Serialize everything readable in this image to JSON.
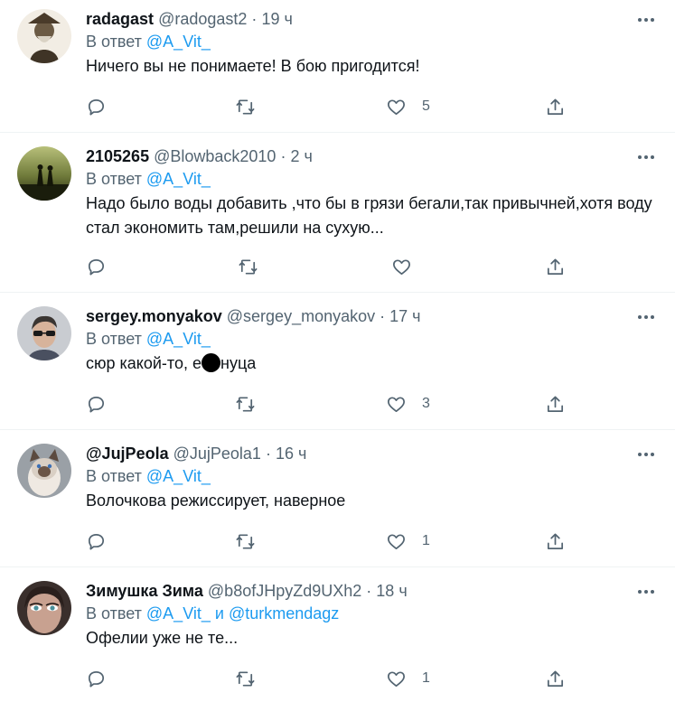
{
  "tweets": [
    {
      "name": "radagast",
      "handle": "@radogast2",
      "time": "19 ч",
      "reply_prefix": "В ответ",
      "reply_to": "@A_Vit_",
      "reply_joiner": "",
      "reply_to_2": "",
      "text": "Ничего вы не понимаете! В бою пригодится!",
      "likes": "5"
    },
    {
      "name": "2105265",
      "handle": "@Blowback2010",
      "time": "2 ч",
      "reply_prefix": "В ответ",
      "reply_to": "@A_Vit_",
      "reply_joiner": "",
      "reply_to_2": "",
      "text": "Надо было воды добавить ,что бы в грязи бегали,так привычней,хотя воду стал экономить там,решили на сухую...",
      "likes": ""
    },
    {
      "name": "sergey.monyakov",
      "handle": "@sergey_monyakov",
      "time": "17 ч",
      "reply_prefix": "В ответ",
      "reply_to": "@A_Vit_",
      "reply_joiner": "",
      "reply_to_2": "",
      "text_before": "сюр какой-то, е",
      "text_after": "нуца",
      "likes": "3"
    },
    {
      "name": "@JujPeola",
      "handle": "@JujPeola1",
      "time": "16 ч",
      "reply_prefix": "В ответ",
      "reply_to": "@A_Vit_",
      "reply_joiner": "",
      "reply_to_2": "",
      "text": "Волочкова режиссирует, наверное",
      "likes": "1"
    },
    {
      "name": "Зимушка Зима",
      "handle": "@b8ofJHpyZd9UXh2",
      "time": "18 ч",
      "reply_prefix": "В ответ",
      "reply_to": "@A_Vit_",
      "reply_joiner": "и",
      "reply_to_2": "@turkmendagz",
      "text": "Офелии уже не те...",
      "likes": "1"
    }
  ],
  "separator": "·",
  "colors": {
    "accent": "#1d9bf0",
    "muted": "#536471",
    "text": "#0f1419",
    "border": "#eff3f4"
  },
  "icons": [
    "reply-icon",
    "retweet-icon",
    "like-icon",
    "share-icon",
    "more-icon"
  ]
}
